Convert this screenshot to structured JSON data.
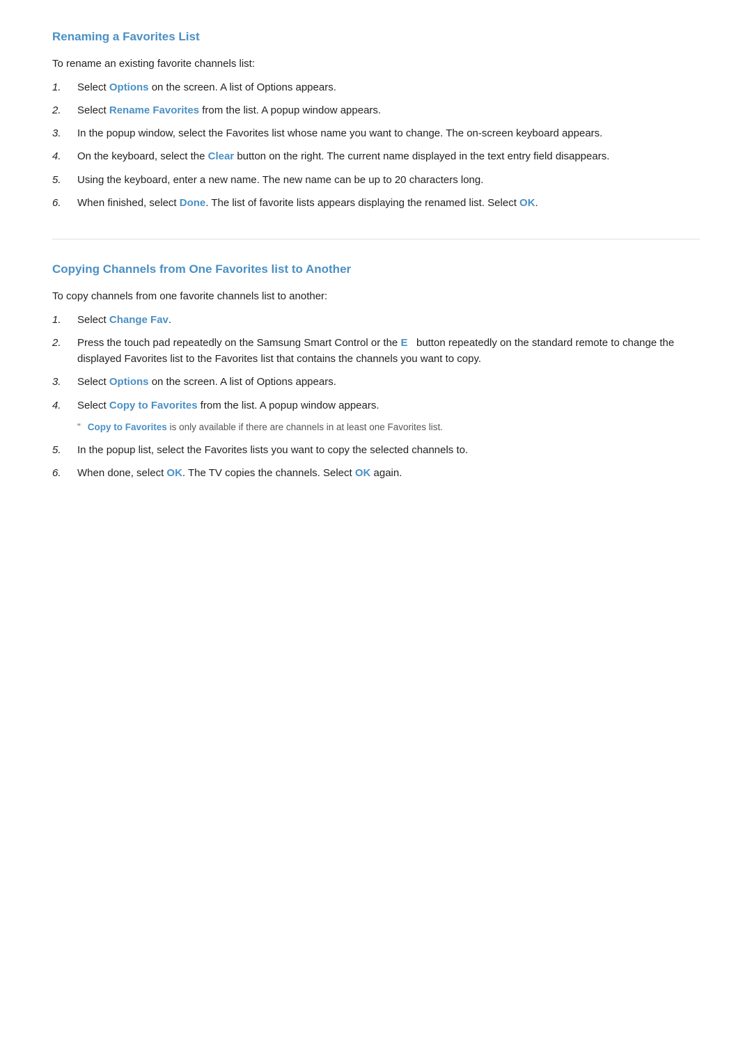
{
  "section1": {
    "title": "Renaming a Favorites List",
    "intro": "To rename an existing favorite channels list:",
    "steps": [
      {
        "number": "1.",
        "text_before": "Select ",
        "highlight": "Options",
        "text_after": " on the screen. A list of Options appears."
      },
      {
        "number": "2.",
        "text_before": "Select ",
        "highlight": "Rename Favorites",
        "text_after": " from the list. A popup window appears."
      },
      {
        "number": "3.",
        "text_before": "",
        "highlight": "",
        "text_after": "In the popup window, select the Favorites list whose name you want to change. The on-screen keyboard appears."
      },
      {
        "number": "4.",
        "text_before": "On the keyboard, select the ",
        "highlight": "Clear",
        "text_after": " button on the right. The current name displayed in the text entry field disappears."
      },
      {
        "number": "5.",
        "text_before": "",
        "highlight": "",
        "text_after": "Using the keyboard, enter a new name. The new name can be up to 20 characters long."
      },
      {
        "number": "6.",
        "text_before": "When finished, select ",
        "highlight": "Done",
        "text_middle": ". The list of favorite lists appears displaying the renamed list. Select ",
        "highlight2": "OK",
        "text_after": "."
      }
    ]
  },
  "section2": {
    "title": "Copying Channels from One Favorites list to Another",
    "intro": "To copy channels from one favorite channels list to another:",
    "steps": [
      {
        "number": "1.",
        "text_before": "Select ",
        "highlight": "Change Fav",
        "text_after": "."
      },
      {
        "number": "2.",
        "text_before": "Press the touch pad repeatedly on the Samsung Smart Control or the ",
        "highlight": "E",
        "text_after": "  button repeatedly on the standard remote to change the displayed Favorites list to the Favorites list that contains the channels you want to copy."
      },
      {
        "number": "3.",
        "text_before": "Select ",
        "highlight": "Options",
        "text_after": " on the screen. A list of Options appears."
      },
      {
        "number": "4.",
        "text_before": "Select ",
        "highlight": "Copy to Favorites",
        "text_after": " from the list. A popup window appears.",
        "note": {
          "quote": "\"",
          "highlight": "Copy to Favorites",
          "text": " is only available if there are channels in at least one Favorites list."
        }
      },
      {
        "number": "5.",
        "text_before": "",
        "highlight": "",
        "text_after": "In the popup list, select the Favorites lists you want to copy the selected channels to."
      },
      {
        "number": "6.",
        "text_before": "When done, select ",
        "highlight": "OK",
        "text_middle": ". The TV copies the channels. Select ",
        "highlight2": "OK",
        "text_after": " again."
      }
    ]
  }
}
